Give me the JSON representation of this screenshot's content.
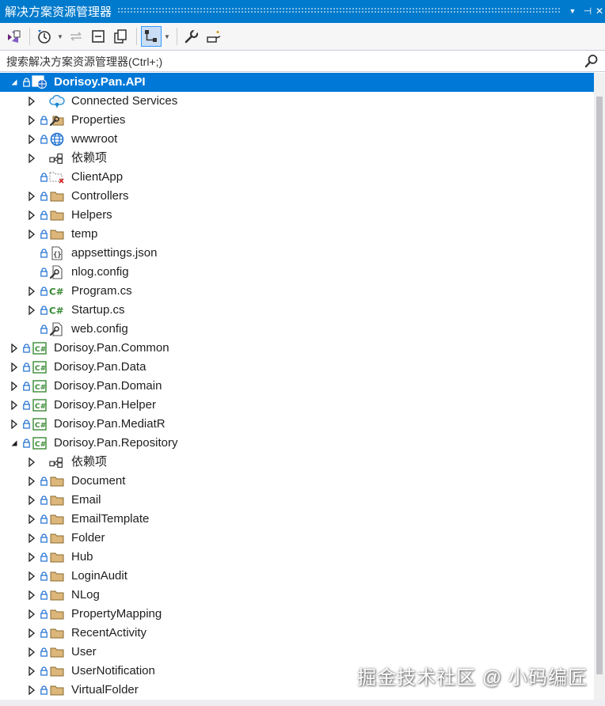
{
  "window": {
    "title": "解决方案资源管理器",
    "pin_glyph": "⊣",
    "close_glyph": "✕",
    "menu_glyph": "▼"
  },
  "search": {
    "placeholder": "搜索解决方案资源管理器(Ctrl+;)"
  },
  "colors": {
    "accent": "#007acc",
    "selection": "#0078d7",
    "folder": "#dcb67a",
    "csharp": "#388a34"
  },
  "tree": [
    {
      "label": "Dorisoy.Pan.API",
      "level": 0,
      "expander": "expanded",
      "lock": true,
      "icon": "web-project-icon",
      "selected": true
    },
    {
      "label": "Connected Services",
      "level": 1,
      "expander": "collapsed",
      "lock": false,
      "icon": "connected-services-icon"
    },
    {
      "label": "Properties",
      "level": 1,
      "expander": "collapsed",
      "lock": true,
      "icon": "properties-icon"
    },
    {
      "label": "wwwroot",
      "level": 1,
      "expander": "collapsed",
      "lock": true,
      "icon": "globe-icon"
    },
    {
      "label": "依赖项",
      "level": 1,
      "expander": "collapsed",
      "lock": false,
      "icon": "dependencies-icon"
    },
    {
      "label": "ClientApp",
      "level": 1,
      "expander": "none",
      "lock": true,
      "icon": "missing-folder-icon"
    },
    {
      "label": "Controllers",
      "level": 1,
      "expander": "collapsed",
      "lock": true,
      "icon": "folder-icon"
    },
    {
      "label": "Helpers",
      "level": 1,
      "expander": "collapsed",
      "lock": true,
      "icon": "folder-icon"
    },
    {
      "label": "temp",
      "level": 1,
      "expander": "collapsed",
      "lock": true,
      "icon": "folder-icon"
    },
    {
      "label": "appsettings.json",
      "level": 1,
      "expander": "none",
      "lock": true,
      "icon": "json-file-icon"
    },
    {
      "label": "nlog.config",
      "level": 1,
      "expander": "none",
      "lock": true,
      "icon": "config-file-icon"
    },
    {
      "label": "Program.cs",
      "level": 1,
      "expander": "collapsed",
      "lock": true,
      "icon": "csharp-file-icon"
    },
    {
      "label": "Startup.cs",
      "level": 1,
      "expander": "collapsed",
      "lock": true,
      "icon": "csharp-file-icon"
    },
    {
      "label": "web.config",
      "level": 1,
      "expander": "none",
      "lock": true,
      "icon": "config-file-icon"
    },
    {
      "label": "Dorisoy.Pan.Common",
      "level": 0,
      "expander": "collapsed",
      "lock": true,
      "icon": "csharp-project-icon"
    },
    {
      "label": "Dorisoy.Pan.Data",
      "level": 0,
      "expander": "collapsed",
      "lock": true,
      "icon": "csharp-project-icon"
    },
    {
      "label": "Dorisoy.Pan.Domain",
      "level": 0,
      "expander": "collapsed",
      "lock": true,
      "icon": "csharp-project-icon"
    },
    {
      "label": "Dorisoy.Pan.Helper",
      "level": 0,
      "expander": "collapsed",
      "lock": true,
      "icon": "csharp-project-icon"
    },
    {
      "label": "Dorisoy.Pan.MediatR",
      "level": 0,
      "expander": "collapsed",
      "lock": true,
      "icon": "csharp-project-icon"
    },
    {
      "label": "Dorisoy.Pan.Repository",
      "level": 0,
      "expander": "expanded",
      "lock": true,
      "icon": "csharp-project-icon"
    },
    {
      "label": "依赖项",
      "level": 1,
      "expander": "collapsed",
      "lock": false,
      "icon": "dependencies-icon"
    },
    {
      "label": "Document",
      "level": 1,
      "expander": "collapsed",
      "lock": true,
      "icon": "folder-icon"
    },
    {
      "label": "Email",
      "level": 1,
      "expander": "collapsed",
      "lock": true,
      "icon": "folder-icon"
    },
    {
      "label": "EmailTemplate",
      "level": 1,
      "expander": "collapsed",
      "lock": true,
      "icon": "folder-icon"
    },
    {
      "label": "Folder",
      "level": 1,
      "expander": "collapsed",
      "lock": true,
      "icon": "folder-icon"
    },
    {
      "label": "Hub",
      "level": 1,
      "expander": "collapsed",
      "lock": true,
      "icon": "folder-icon"
    },
    {
      "label": "LoginAudit",
      "level": 1,
      "expander": "collapsed",
      "lock": true,
      "icon": "folder-icon"
    },
    {
      "label": "NLog",
      "level": 1,
      "expander": "collapsed",
      "lock": true,
      "icon": "folder-icon"
    },
    {
      "label": "PropertyMapping",
      "level": 1,
      "expander": "collapsed",
      "lock": true,
      "icon": "folder-icon"
    },
    {
      "label": "RecentActivity",
      "level": 1,
      "expander": "collapsed",
      "lock": true,
      "icon": "folder-icon"
    },
    {
      "label": "User",
      "level": 1,
      "expander": "collapsed",
      "lock": true,
      "icon": "folder-icon"
    },
    {
      "label": "UserNotification",
      "level": 1,
      "expander": "collapsed",
      "lock": true,
      "icon": "folder-icon"
    },
    {
      "label": "VirtualFolder",
      "level": 1,
      "expander": "collapsed",
      "lock": true,
      "icon": "folder-icon"
    }
  ],
  "watermark": "掘金技术社区 @ 小码编匠"
}
